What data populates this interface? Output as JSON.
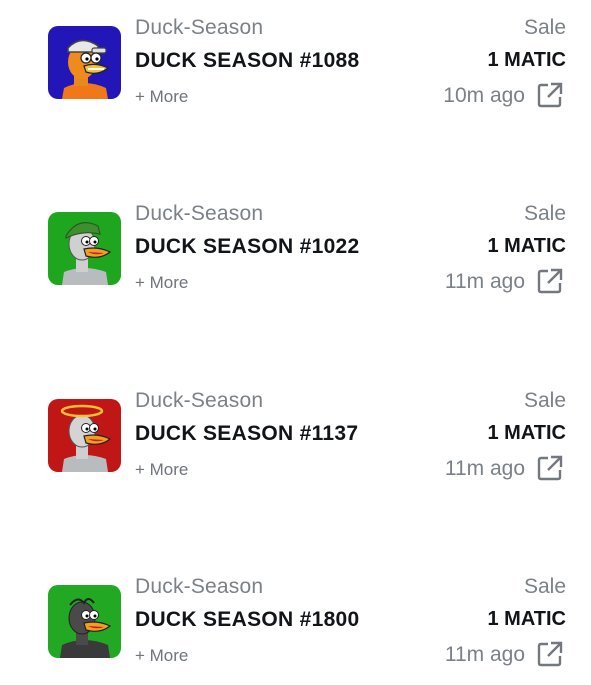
{
  "activity": [
    {
      "collection": "Duck-Season",
      "name": "DUCK SEASON #1088",
      "more_label": "+ More",
      "event": "Sale",
      "price": "1 MATIC",
      "time": "10m ago",
      "bg": "#2216b8",
      "icon": "external-link-icon"
    },
    {
      "collection": "Duck-Season",
      "name": "DUCK SEASON #1022",
      "more_label": "+ More",
      "event": "Sale",
      "price": "1 MATIC",
      "time": "11m ago",
      "bg": "#1fa61f",
      "icon": "external-link-icon"
    },
    {
      "collection": "Duck-Season",
      "name": "DUCK SEASON #1137",
      "more_label": "+ More",
      "event": "Sale",
      "price": "1 MATIC",
      "time": "11m ago",
      "bg": "#c01616",
      "icon": "external-link-icon"
    },
    {
      "collection": "Duck-Season",
      "name": "DUCK SEASON #1800",
      "more_label": "+ More",
      "event": "Sale",
      "price": "1 MATIC",
      "time": "11m ago",
      "bg": "#22a822",
      "icon": "external-link-icon"
    }
  ]
}
